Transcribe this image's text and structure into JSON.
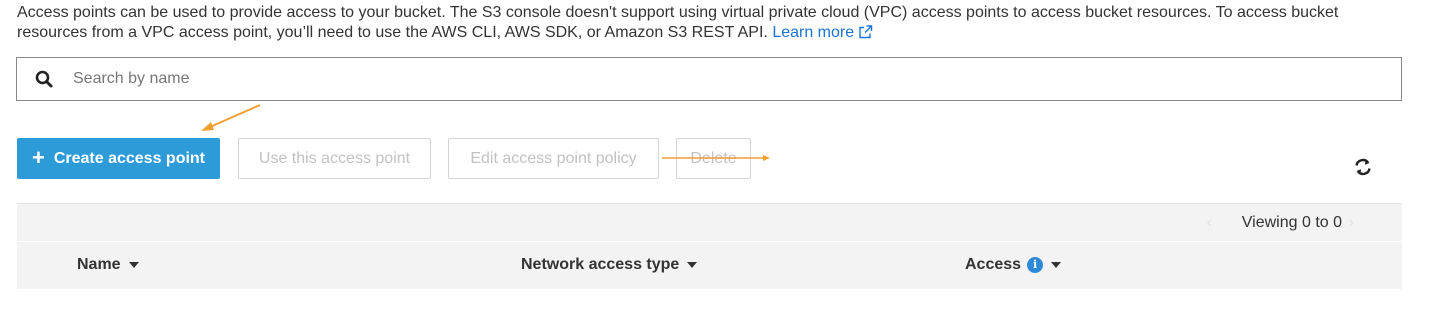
{
  "intro": {
    "text": "Access points can be used to provide access to your bucket. The S3 console doesn't support using virtual private cloud (VPC) access points to access bucket resources. To access bucket resources from a VPC access point, you’ll need to use the AWS CLI, AWS SDK, or Amazon S3 REST API.",
    "link_label": "Learn more",
    "link_icon": "external-link-icon"
  },
  "search": {
    "placeholder": "Search by name",
    "value": "",
    "icon": "search-icon"
  },
  "toolbar": {
    "create_label": "Create access point",
    "create_icon": "plus-icon",
    "use_label": "Use this access point",
    "edit_label": "Edit access point policy",
    "delete_label": "Delete",
    "refresh_icon": "refresh-icon"
  },
  "pagination": {
    "viewing_label": "Viewing 0 to 0",
    "prev_icon": "‹",
    "next_icon": "›"
  },
  "table": {
    "columns": [
      {
        "label": "Name"
      },
      {
        "label": "Network access type"
      },
      {
        "label": "Access"
      }
    ],
    "rows": []
  },
  "colors": {
    "primary": "#2e9bd9",
    "link": "#1a73d6",
    "annotation": "#f0a030",
    "info": "#2e8ad8"
  }
}
